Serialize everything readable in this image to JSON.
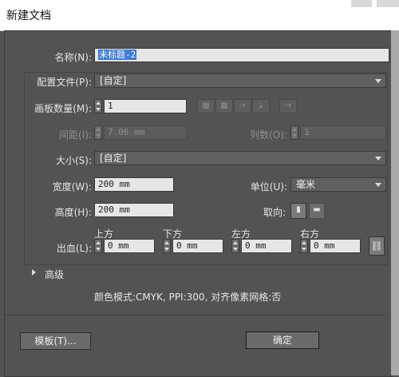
{
  "window": {
    "title": "新建文档"
  },
  "form": {
    "name_label": "名称(N):",
    "name_value": "未标题-2",
    "profile_label": "配置文件(P):",
    "profile_value": "[自定]",
    "artboards_label": "画板数量(M):",
    "artboards_value": "1",
    "spacing_label": "间距(I):",
    "spacing_value": "7.06 mm",
    "columns_label": "列数(O):",
    "columns_value": "1",
    "size_label": "大小(S):",
    "size_value": "[自定]",
    "width_label": "宽度(W):",
    "width_value": "200 mm",
    "units_label": "单位(U):",
    "units_value": "毫米",
    "height_label": "高度(H):",
    "height_value": "200 mm",
    "orientation_label": "取向:",
    "bleed_label": "出血(L):",
    "bleed": {
      "top_label": "上方",
      "top_value": "0 mm",
      "bottom_label": "下方",
      "bottom_value": "0 mm",
      "left_label": "左方",
      "left_value": "0 mm",
      "right_label": "右方",
      "right_value": "0 mm"
    },
    "advanced_label": "高级",
    "info_text": "颜色模式:CMYK, PPI:300, 对齐像素网格:否"
  },
  "buttons": {
    "templates": "模板(T)...",
    "ok": "确定"
  },
  "icons": {
    "artboard_layout": [
      "grid-by-row-icon",
      "grid-by-column-icon",
      "arrange-by-row-icon",
      "arrange-by-column-icon",
      "right-to-left-icon"
    ],
    "orientation": [
      "portrait-icon",
      "landscape-icon"
    ],
    "link": "chain-link-icon",
    "disclosure": "disclosure-triangle-icon"
  },
  "colors": {
    "panel": "#535353",
    "selection": "#3d7bd6"
  }
}
